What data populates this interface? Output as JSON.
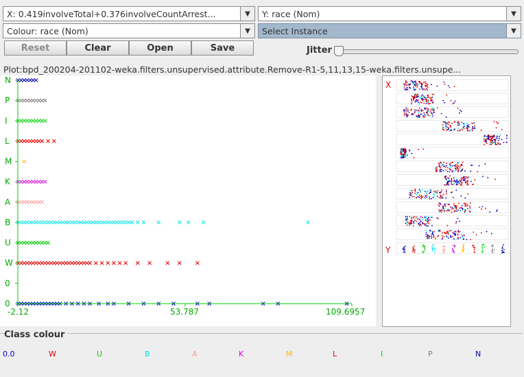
{
  "x_axis_select": "X: 0.419involveTotal+0.376involveCountArrest...",
  "y_axis_select": "Y: race (Nom)",
  "colour_select": "Colour: race (Nom)",
  "instance_select": "Select Instance",
  "buttons": {
    "reset": "Reset",
    "clear": "Clear",
    "open": "Open",
    "save": "Save"
  },
  "jitter_label": "Jitter",
  "jitter_value": 0,
  "plot_title": "Plot:bpd_200204-201102-weka.filters.unsupervised.attribute.Remove-R1-5,11,13,15-weka.filters.unsupe...",
  "mini_labels": {
    "x": "X",
    "y": "Y"
  },
  "legend_title": "Class colour",
  "classes": [
    {
      "label": "0.0",
      "color": "#0000cc"
    },
    {
      "label": "W",
      "color": "#e00000"
    },
    {
      "label": "U",
      "color": "#00cc00"
    },
    {
      "label": "B",
      "color": "#00e5e5"
    },
    {
      "label": "A",
      "color": "#ff9999"
    },
    {
      "label": "K",
      "color": "#dd00dd"
    },
    {
      "label": "M",
      "color": "#ffbb00"
    },
    {
      "label": "L",
      "color": "#ee0000"
    },
    {
      "label": "I",
      "color": "#00dd00"
    },
    {
      "label": "P",
      "color": "#808080"
    },
    {
      "label": "N",
      "color": "#0000aa"
    }
  ],
  "chart_data": {
    "type": "scatter",
    "x_label": "",
    "y_label": "",
    "x_ticks": [
      "-2.12",
      "53.787",
      "109.6957"
    ],
    "xlim": [
      -2.12,
      109.6957
    ],
    "y_categories": [
      "0",
      "0",
      "W",
      "U",
      "B",
      "A",
      "K",
      "M",
      "L",
      "I",
      "P",
      "N"
    ],
    "series": [
      {
        "category": "0",
        "color": "#0000cc",
        "x": [
          -2,
          -1,
          0,
          1,
          2,
          3,
          4,
          5,
          6,
          7,
          8,
          9,
          10,
          11,
          12,
          14,
          16,
          18,
          20,
          22,
          25,
          28,
          30,
          35,
          40,
          45,
          50,
          58,
          62,
          80,
          85,
          108
        ]
      },
      {
        "category": "W",
        "color": "#e00000",
        "x": [
          -2,
          -1,
          0,
          1,
          2,
          3,
          4,
          5,
          6,
          7,
          8,
          9,
          10,
          11,
          12,
          13,
          14,
          15,
          16,
          17,
          18,
          19,
          20,
          21,
          22,
          24,
          26,
          28,
          30,
          32,
          34,
          38,
          42,
          48,
          52,
          58
        ]
      },
      {
        "category": "U",
        "color": "#00cc00",
        "x": [
          -2,
          -1,
          0,
          1,
          2,
          3,
          4,
          5,
          6,
          7,
          8
        ]
      },
      {
        "category": "B",
        "color": "#00e5e5",
        "x": [
          -2,
          -1,
          0,
          1,
          2,
          3,
          4,
          5,
          6,
          7,
          8,
          9,
          10,
          11,
          12,
          13,
          14,
          15,
          16,
          17,
          18,
          19,
          20,
          21,
          22,
          23,
          24,
          25,
          26,
          27,
          28,
          29,
          30,
          31,
          32,
          33,
          34,
          35,
          36,
          38,
          40,
          45,
          52,
          55,
          60,
          95
        ]
      },
      {
        "category": "A",
        "color": "#ff9999",
        "x": [
          -2,
          -1,
          0,
          1,
          2,
          3,
          4,
          5,
          6
        ]
      },
      {
        "category": "K",
        "color": "#dd00dd",
        "x": [
          -2,
          -1,
          0,
          1,
          2,
          3,
          4,
          5,
          6,
          7
        ]
      },
      {
        "category": "M",
        "color": "#ffbb00",
        "x": [
          0
        ]
      },
      {
        "category": "L",
        "color": "#ee0000",
        "x": [
          -2,
          -1,
          0,
          1,
          2,
          3,
          4,
          5,
          6,
          8,
          10
        ]
      },
      {
        "category": "I",
        "color": "#00dd00",
        "x": [
          -2,
          -1,
          0,
          1,
          2,
          3,
          4,
          5,
          6,
          7
        ]
      },
      {
        "category": "P",
        "color": "#808080",
        "x": [
          -2,
          -1,
          0,
          1,
          2,
          3,
          4,
          5,
          6,
          7
        ]
      },
      {
        "category": "N",
        "color": "#0000aa",
        "x": [
          -2,
          -1,
          0,
          1,
          2,
          3,
          4
        ]
      }
    ]
  }
}
